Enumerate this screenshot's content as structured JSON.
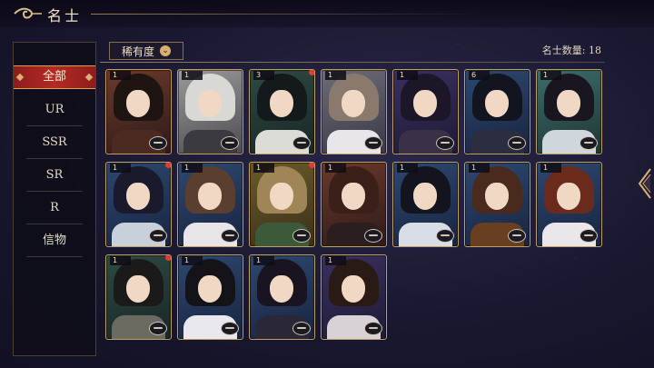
{
  "header": {
    "title": "名士"
  },
  "sidebar": {
    "tabs": [
      {
        "label": "全部",
        "active": true
      },
      {
        "label": "UR"
      },
      {
        "label": "SSR"
      },
      {
        "label": "SR"
      },
      {
        "label": "R"
      },
      {
        "label": "信物"
      }
    ]
  },
  "filter": {
    "label": "稀有度",
    "icon": "chevron-down-icon"
  },
  "count": {
    "text": "名士数量: 18"
  },
  "cards": [
    {
      "rank": "1",
      "dot": false,
      "bg": "c-warm",
      "hair": "#1e1412",
      "body": "#4a2a22"
    },
    {
      "rank": "1",
      "dot": false,
      "bg": "c-gray",
      "hair": "#d8d8d4",
      "body": "#3a3a40"
    },
    {
      "rank": "3",
      "dot": true,
      "bg": "c-green",
      "hair": "#141a1c",
      "body": "#dcdcd6"
    },
    {
      "rank": "1",
      "dot": false,
      "bg": "c-fur",
      "hair": "#8a7a6e",
      "body": "#e8e6ea"
    },
    {
      "rank": "1",
      "dot": false,
      "bg": "c-purple",
      "hair": "#1c1628",
      "body": "#3a3048"
    },
    {
      "rank": "6",
      "dot": false,
      "bg": "c-blue",
      "hair": "#121420",
      "body": "#2a2e40"
    },
    {
      "rank": "1",
      "dot": false,
      "bg": "c-teal",
      "hair": "#1a1620",
      "body": "#cfd6dc"
    },
    {
      "rank": "1",
      "dot": true,
      "bg": "c-blue",
      "hair": "#1a1a2c",
      "body": "#c8d0dc"
    },
    {
      "rank": "1",
      "dot": false,
      "bg": "c-blue",
      "hair": "#5a3e2e",
      "body": "#e8e4ea"
    },
    {
      "rank": "1",
      "dot": true,
      "bg": "c-gold",
      "hair": "#a08656",
      "body": "#3a5a3a"
    },
    {
      "rank": "1",
      "dot": false,
      "bg": "c-warm",
      "hair": "#3a2018",
      "body": "#2a1e1e"
    },
    {
      "rank": "1",
      "dot": false,
      "bg": "c-blue",
      "hair": "#14141e",
      "body": "#d8dde6"
    },
    {
      "rank": "1",
      "dot": false,
      "bg": "c-blue",
      "hair": "#4a2a1c",
      "body": "#6a3e20"
    },
    {
      "rank": "1",
      "dot": false,
      "bg": "c-blue",
      "hair": "#6a2a1c",
      "body": "#ebe6ea"
    },
    {
      "rank": "1",
      "dot": true,
      "bg": "c-green",
      "hair": "#1a1a1a",
      "body": "#6a6a60"
    },
    {
      "rank": "1",
      "dot": false,
      "bg": "c-blue",
      "hair": "#141418",
      "body": "#e8e8ee"
    },
    {
      "rank": "1",
      "dot": false,
      "bg": "c-blue",
      "hair": "#1a1420",
      "body": "#2a2838"
    },
    {
      "rank": "1",
      "dot": false,
      "bg": "c-purple",
      "hair": "#2a1a14",
      "body": "#d8d2d6"
    }
  ]
}
